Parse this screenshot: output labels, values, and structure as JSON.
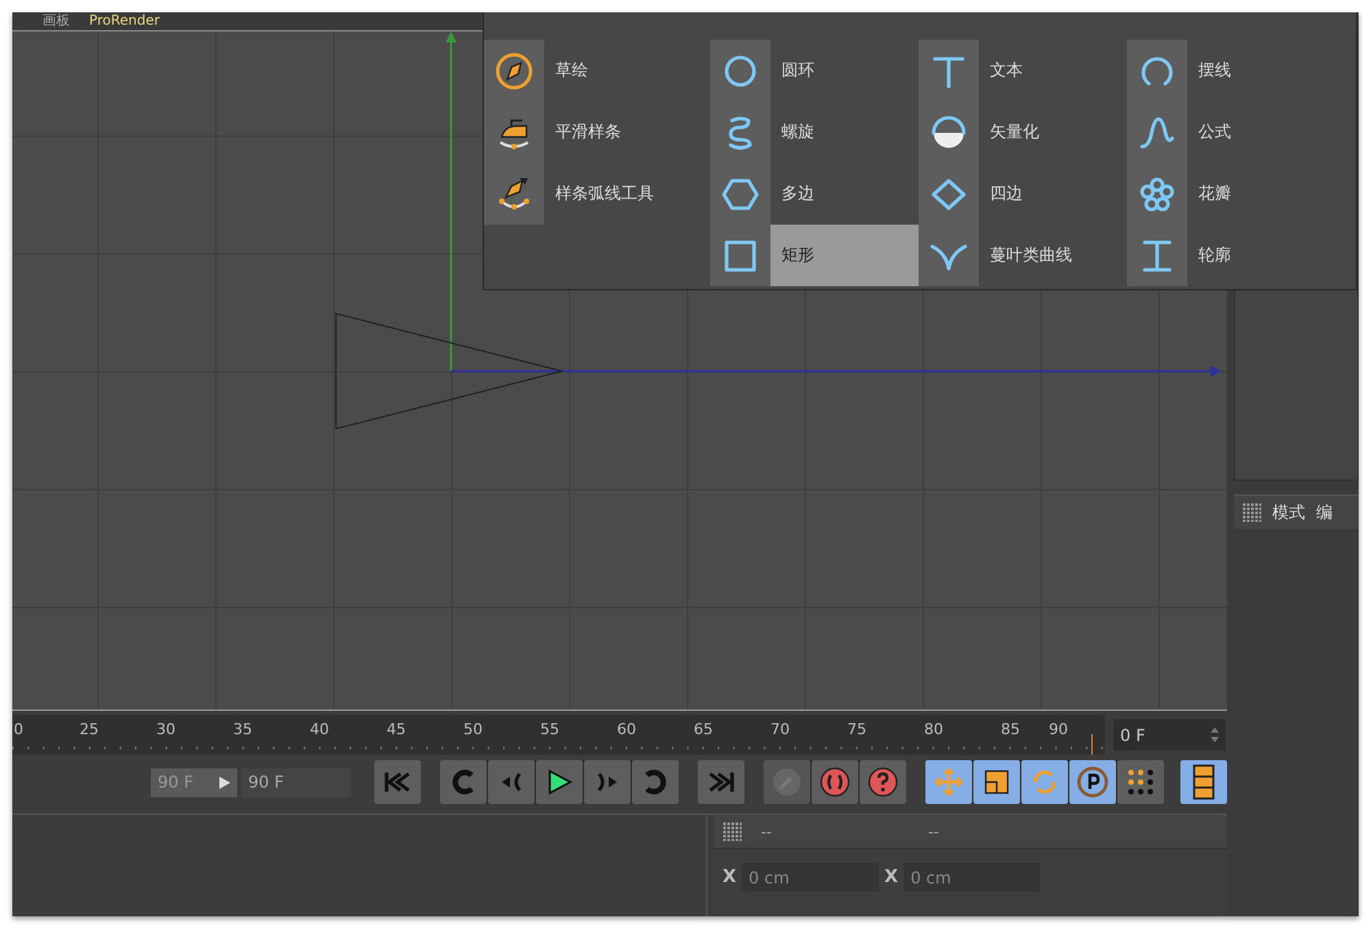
{
  "menu_bar": {
    "items": [
      {
        "label": "画板",
        "highlighted": false
      },
      {
        "label": "ProRender",
        "highlighted": true
      }
    ]
  },
  "spline_menu": {
    "columns": [
      {
        "items": [
          {
            "label": "草绘",
            "selected": false
          },
          {
            "label": "平滑样条",
            "selected": false
          },
          {
            "label": "样条弧线工具",
            "selected": false
          }
        ]
      },
      {
        "items": [
          {
            "label": "圆环",
            "selected": false
          },
          {
            "label": "螺旋",
            "selected": false
          },
          {
            "label": "多边",
            "selected": false
          },
          {
            "label": "矩形",
            "selected": true
          }
        ]
      },
      {
        "items": [
          {
            "label": "文本",
            "selected": false
          },
          {
            "label": "矢量化",
            "selected": false
          },
          {
            "label": "四边",
            "selected": false
          },
          {
            "label": "蔓叶类曲线",
            "selected": false
          }
        ]
      },
      {
        "items": [
          {
            "label": "摆线",
            "selected": false
          },
          {
            "label": "公式",
            "selected": false
          },
          {
            "label": "花瓣",
            "selected": false
          },
          {
            "label": "轮廓",
            "selected": false
          }
        ]
      }
    ]
  },
  "timeline": {
    "ruler_labels": [
      "0",
      "25",
      "30",
      "35",
      "40",
      "45",
      "50",
      "55",
      "60",
      "65",
      "70",
      "75",
      "80",
      "85",
      "90"
    ],
    "current_frame": "0 F"
  },
  "playback": {
    "min_frame": "90 F",
    "max_frame": "90 F",
    "keyframe_buttons": [
      {
        "disabled": true
      },
      {
        "disabled": false
      },
      {
        "disabled": false
      }
    ],
    "record_toggles": [
      {
        "on": true
      },
      {
        "on": true
      },
      {
        "on": true
      },
      {
        "on": true
      },
      {
        "on": false
      }
    ],
    "timeline_toggle": {
      "on": true
    }
  },
  "coordinates": {
    "headers": [
      "--",
      "--"
    ],
    "fields": [
      {
        "axis": "X",
        "value": "0 cm"
      },
      {
        "axis": "X",
        "value": "0 cm"
      }
    ]
  },
  "attributes_panel": {
    "tabs": [
      "模式",
      "编"
    ]
  }
}
